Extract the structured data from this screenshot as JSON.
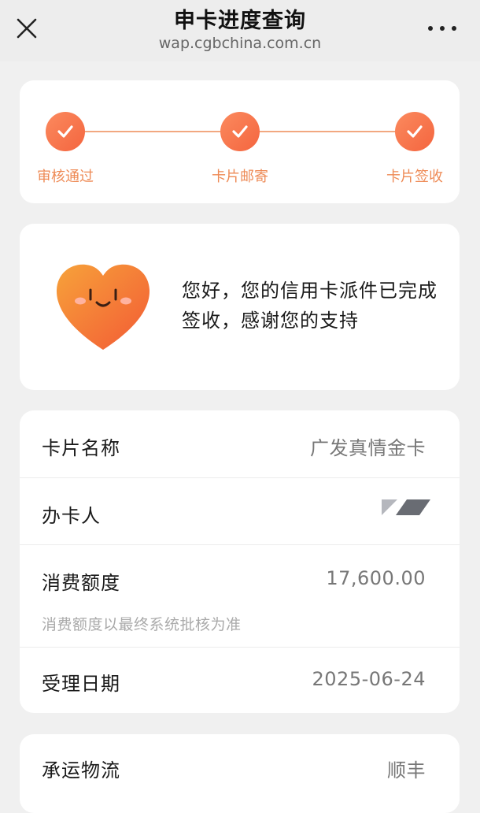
{
  "header": {
    "title": "申卡进度查询",
    "url": "wap.cgbchina.com.cn",
    "close_icon": "close-icon",
    "more_icon": "more-icon"
  },
  "progress": {
    "accent_color": "#f4653f",
    "steps": [
      {
        "label": "审核通过",
        "done": true
      },
      {
        "label": "卡片邮寄",
        "done": true
      },
      {
        "label": "卡片签收",
        "done": true
      }
    ]
  },
  "notice": {
    "icon": "smiling-heart-icon",
    "message": "您好，您的信用卡派件已完成签收，感谢您的支持"
  },
  "details": {
    "card_name_label": "卡片名称",
    "card_name_value": "广发真情金卡",
    "applicant_label": "办卡人",
    "credit_limit_label": "消费额度",
    "credit_limit_value": "17,600.00",
    "credit_limit_note": "消费额度以最终系统批核为准",
    "accept_date_label": "受理日期",
    "accept_date_value": "2025-06-24"
  },
  "logistics": {
    "carrier_label": "承运物流",
    "carrier_value": "顺丰"
  }
}
